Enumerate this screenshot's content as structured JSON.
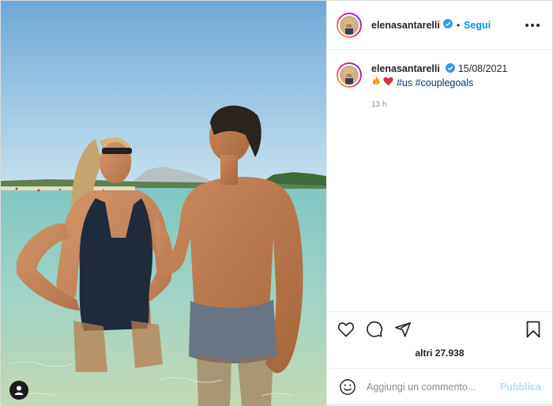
{
  "header": {
    "username": "elenasantarelli",
    "separator": "•",
    "follow_label": "Segui"
  },
  "caption": {
    "username": "elenasantarelli",
    "date": "15/08/2021",
    "hashtags": [
      "#us",
      "#couplegoals"
    ],
    "time_ago": "13 h"
  },
  "likes": {
    "text": "altri 27.938"
  },
  "comment_box": {
    "placeholder": "Aggiungi un commento...",
    "publish_label": "Pubblica"
  },
  "icons": {
    "verified": "verified-badge-icon",
    "more": "more-options-icon",
    "like": "heart-icon",
    "comment": "comment-bubble-icon",
    "share": "paper-plane-icon",
    "save": "bookmark-icon",
    "emoji": "emoji-icon",
    "tags": "user-tag-icon"
  },
  "colors": {
    "accent": "#0095f6",
    "verified": "#3897f0",
    "publish_disabled": "#b2dffc"
  }
}
